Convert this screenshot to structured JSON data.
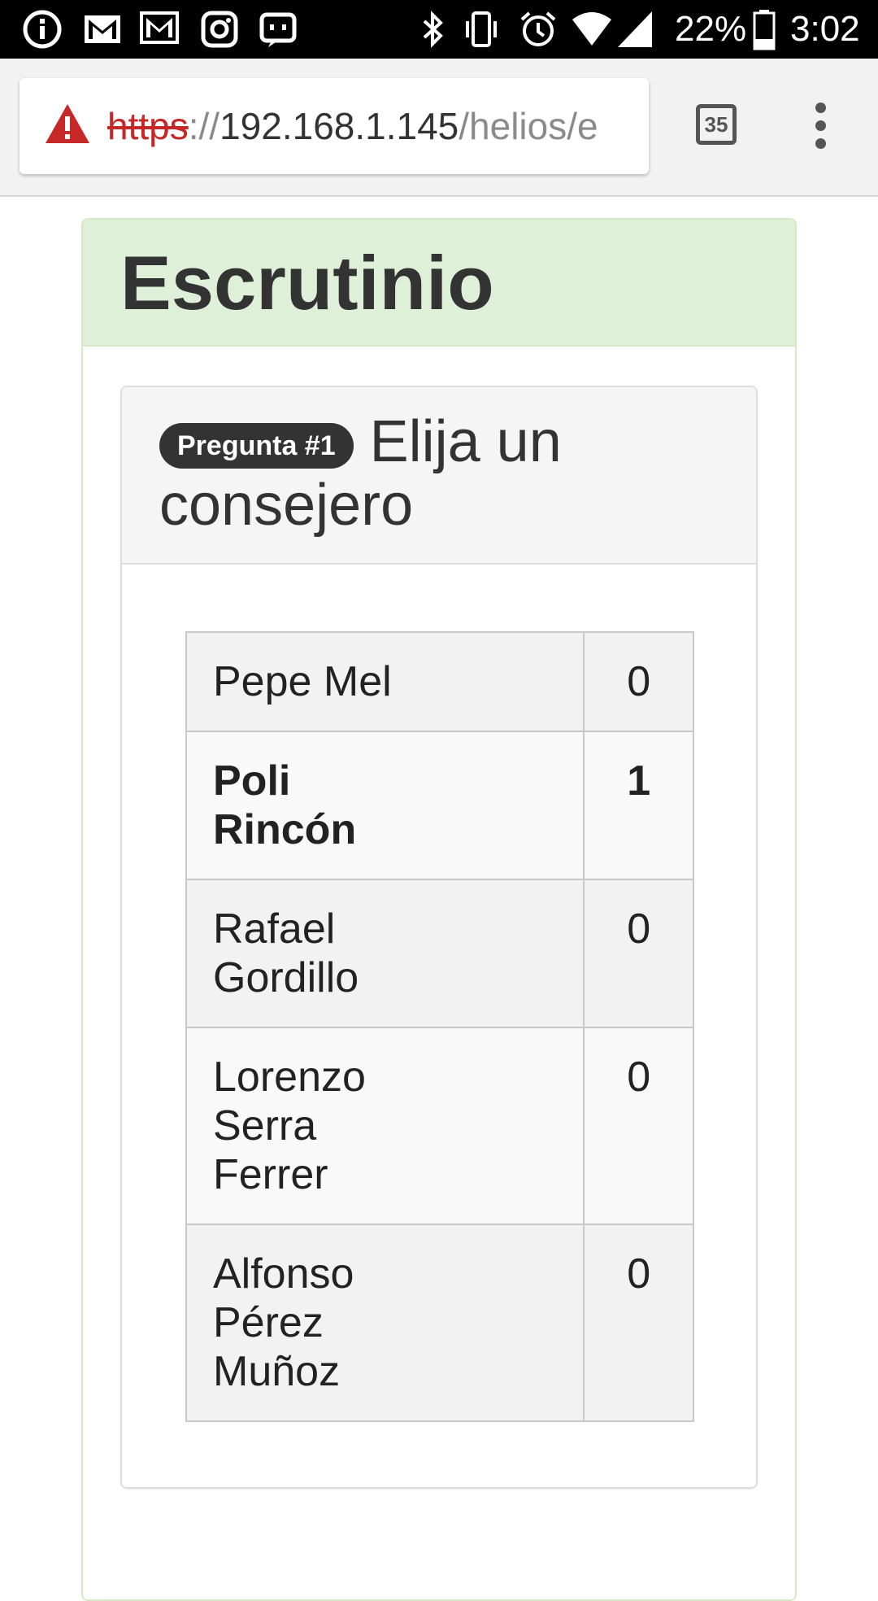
{
  "status_bar": {
    "battery": "22%",
    "time": "3:02",
    "icons": [
      "info-icon",
      "gmail-icon",
      "gmail-icon",
      "instagram-icon",
      "messenger-icon",
      "bluetooth-icon",
      "vibrate-icon",
      "alarm-icon",
      "wifi-icon",
      "signal-icon",
      "battery-icon"
    ]
  },
  "browser": {
    "url_scheme": "https",
    "url_separator": "://",
    "url_host": "192.168.1.145",
    "url_path": "/helios/e",
    "tab_count": "35"
  },
  "page": {
    "title": "Escrutinio",
    "question": {
      "badge": "Pregunta #1",
      "text": "Elija un consejero"
    },
    "results": [
      {
        "name": "Pepe Mel",
        "votes": "0"
      },
      {
        "name": "Poli Rincón",
        "votes": "1"
      },
      {
        "name": "Rafael Gordillo",
        "votes": "0"
      },
      {
        "name": "Lorenzo Serra Ferrer",
        "votes": "0"
      },
      {
        "name": "Alfonso Pérez Muñoz",
        "votes": "0"
      }
    ]
  },
  "colors": {
    "panel_heading_bg": "#dff0d8",
    "warning_red": "#c62828",
    "badge_bg": "#333333"
  }
}
